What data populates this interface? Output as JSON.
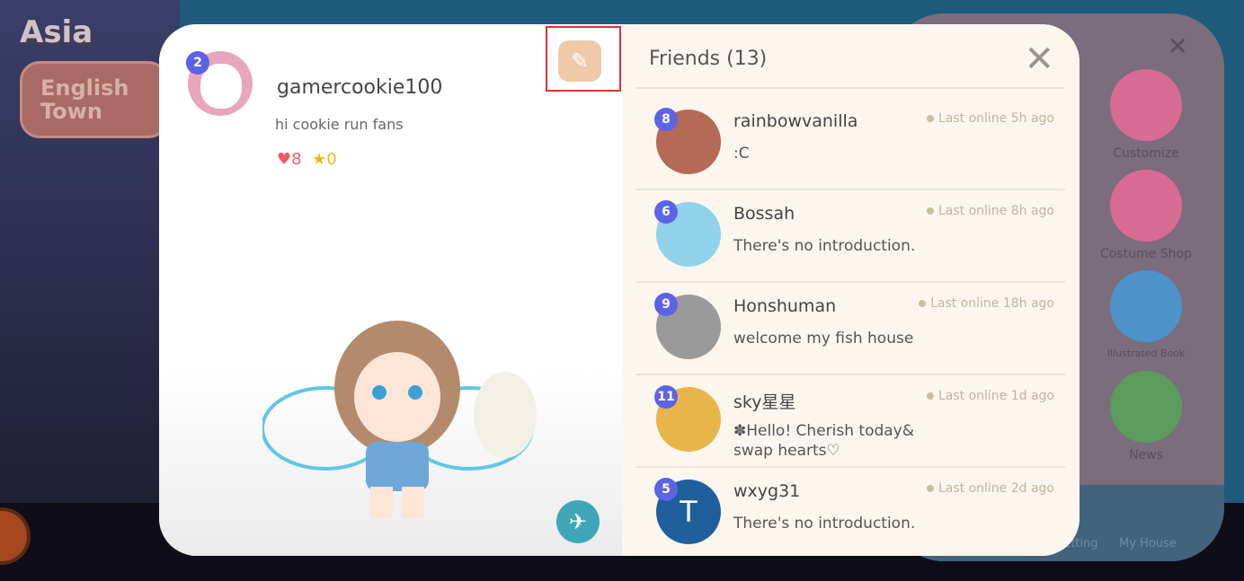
{
  "background": {
    "region": "Asia",
    "town_sign": "English Town"
  },
  "menu": {
    "items": [
      {
        "label": "Customize",
        "color": "#d86b94"
      },
      {
        "label": "Costume Shop",
        "color": "#d86b94"
      },
      {
        "label": "Illustrated Book",
        "color": "#4d92c9"
      },
      {
        "label": "News",
        "color": "#5b9c5c"
      }
    ],
    "footer": {
      "setting": "Setting",
      "my_house": "My House"
    }
  },
  "profile": {
    "level": "2",
    "username": "gamercookie100",
    "bio": "hi cookie run fans",
    "hearts": "8",
    "stars": "0"
  },
  "friends": {
    "title": "Friends (13)",
    "list": [
      {
        "level": "8",
        "name": "rainbowvanilla",
        "message": ":C",
        "last_online": "Last online 5h ago",
        "avatar_color": "#b46a54"
      },
      {
        "level": "6",
        "name": "Bossah",
        "message": "There's no introduction.",
        "last_online": "Last online 8h ago",
        "avatar_color": "#8fd2ea"
      },
      {
        "level": "9",
        "name": "Honshuman",
        "message": "welcome my fish house",
        "last_online": "Last online 18h ago",
        "avatar_color": "#9a9a9a"
      },
      {
        "level": "11",
        "name": "sky星星",
        "message": "✽Hello! Cherish today& swap hearts♡",
        "last_online": "Last online 1d ago",
        "avatar_color": "#e8b54a"
      },
      {
        "level": "5",
        "name": "wxyg31",
        "message": "There's no introduction.",
        "last_online": "Last online 2d ago",
        "avatar_color": "#1f5f9c",
        "initial": "T"
      }
    ]
  },
  "colors": {
    "level_badge": "#5b63e6",
    "heart": "#ef5a66",
    "star": "#f5b617",
    "highlight": "#e0322c"
  }
}
